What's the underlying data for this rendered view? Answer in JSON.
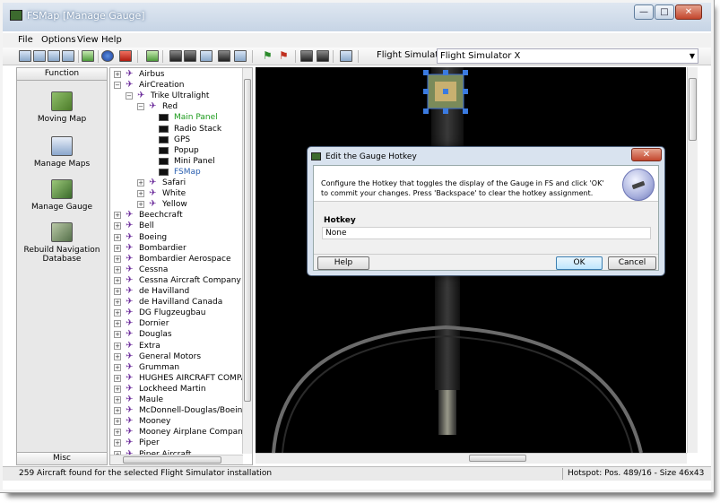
{
  "window": {
    "title": "FSMap [Manage Gauge]",
    "controls": {
      "minimize": "—",
      "maximize": "□",
      "close": "✕"
    }
  },
  "menu": [
    "File",
    "Options",
    "View",
    "Help"
  ],
  "toolbar": {
    "fs_label": "Flight Simulator",
    "fs_value": "Flight Simulator X"
  },
  "function_panel": {
    "header": "Function",
    "footer": "Misc",
    "items": [
      {
        "label": "Moving Map",
        "icon": "moving-map-icon"
      },
      {
        "label": "Manage Maps",
        "icon": "manage-maps-icon"
      },
      {
        "label": "Manage Gauge",
        "icon": "manage-gauge-icon"
      },
      {
        "label": "Rebuild Navigation Database",
        "icon": "database-icon"
      }
    ]
  },
  "tree": {
    "root_top": [
      "Airbus",
      "AirCreation"
    ],
    "trike": "Trike Ultralight",
    "red": "Red",
    "gauges": [
      "Main Panel",
      "Radio Stack",
      "GPS",
      "Popup",
      "Mini Panel",
      "FSMap"
    ],
    "variants": [
      "Safari",
      "White",
      "Yellow"
    ],
    "manufacturers": [
      "Beechcraft",
      "Bell",
      "Boeing",
      "Bombardier",
      "Bombardier Aerospace",
      "Cessna",
      "Cessna Aircraft Company",
      "de Havilland",
      "de Havilland Canada",
      "DG Flugzeugbau",
      "Dornier",
      "Douglas",
      "Extra",
      "General Motors",
      "Grumman",
      "HUGHES AIRCRAFT COMPANY",
      "Lockheed Martin",
      "Maule",
      "McDonnell-Douglas/Boeing",
      "Mooney",
      "Mooney Airplane Company",
      "Piper",
      "Piper Aircraft"
    ],
    "colors": {
      "gauge_green": "#1a9a1a",
      "gauge_blue": "#2a5fb0",
      "plane": "#6a2a9a"
    }
  },
  "status": {
    "left": "259 Aircraft found for the selected Flight Simulator installation",
    "right": "Hotspot: Pos. 489/16 - Size 46x43"
  },
  "dialog": {
    "title": "Edit the Gauge Hotkey",
    "message": "Configure the Hotkey that toggles the display of the Gauge in FS and click 'OK' to commit your changes. Press 'Backspace' to clear the hotkey assignment.",
    "hotkey_label": "Hotkey",
    "hotkey_value": "None",
    "help": "Help",
    "ok": "OK",
    "cancel": "Cancel",
    "close": "✕"
  }
}
